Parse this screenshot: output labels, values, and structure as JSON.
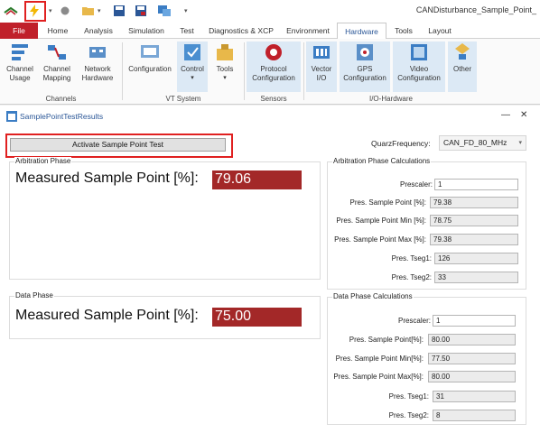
{
  "app_title": "CANDisturbance_Sample_Point_",
  "tabs": [
    "File",
    "Home",
    "Analysis",
    "Simulation",
    "Test",
    "Diagnostics & XCP",
    "Environment",
    "Hardware",
    "Tools",
    "Layout"
  ],
  "ribbon": {
    "channel_usage": "Channel\nUsage",
    "channel_mapping": "Channel\nMapping",
    "network_hardware": "Network\nHardware",
    "configuration": "Configuration",
    "control": "Control",
    "tools": "Tools",
    "protocol_configuration": "Protocol\nConfiguration",
    "vector_io": "Vector\nI/O",
    "gps_configuration": "GPS\nConfiguration",
    "video_configuration": "Video\nConfiguration",
    "other": "Other",
    "groups": [
      "Channels",
      "VT System",
      "Sensors",
      "I/O-Hardware"
    ]
  },
  "window": {
    "title": "SamplePointTestResults",
    "minimize": "—",
    "close": "✕"
  },
  "activate_button": "Activate Sample Point Test",
  "quarz": {
    "label": "QuarzFrequency:",
    "value": "CAN_FD_80_MHz"
  },
  "arbitration": {
    "title": "Arbitration Phase",
    "label": "Measured Sample Point [%]:",
    "value": "79.06"
  },
  "data_phase": {
    "title": "Data Phase",
    "label": "Measured Sample Point [%]:",
    "value": "75.00"
  },
  "arb_calc": {
    "title": "Arbitration Phase Calculations",
    "rows": [
      {
        "label": "Prescaler:",
        "value": "1"
      },
      {
        "label": "Pres. Sample Point [%]:",
        "value": "79.38"
      },
      {
        "label": "Pres. Sample Point Min [%]:",
        "value": "78.75"
      },
      {
        "label": "Pres. Sample Point Max [%]:",
        "value": "79.38"
      },
      {
        "label": "Pres. Tseg1:",
        "value": "126"
      },
      {
        "label": "Pres. Tseg2:",
        "value": "33"
      }
    ]
  },
  "data_calc": {
    "title": "Data Phase Calculations",
    "rows": [
      {
        "label": "Prescaler:",
        "value": "1"
      },
      {
        "label": "Pres. Sample Point[%]:",
        "value": "80.00"
      },
      {
        "label": "Pres. Sample Point Min[%]:",
        "value": "77.50"
      },
      {
        "label": "Pres. Sample Point Max[%]:",
        "value": "80.00"
      },
      {
        "label": "Pres. Tseg1:",
        "value": "31"
      },
      {
        "label": "Pres. Tseg2:",
        "value": "8"
      }
    ]
  },
  "colors": {
    "file_tab": "#c0202a",
    "value_box": "#a32828",
    "highlight_box": "#e02020",
    "accent": "#2b5797"
  }
}
